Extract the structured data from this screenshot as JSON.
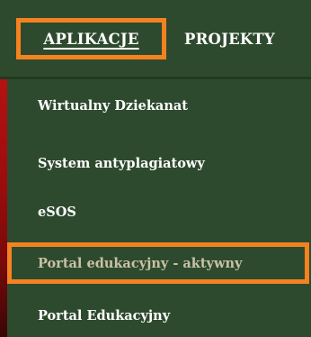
{
  "nav": {
    "items": [
      {
        "label": "APLIKACJE",
        "active": true
      },
      {
        "label": "PROJEKTY",
        "active": false
      }
    ]
  },
  "dropdown": {
    "items": [
      {
        "label": "Wirtualny Dziekanat"
      },
      {
        "label": "System antyplagiatowy"
      },
      {
        "label": "eSOS"
      },
      {
        "label": "Portal edukacyjny - aktywny",
        "highlighted": true
      },
      {
        "label": "Portal Edukacyjny"
      }
    ]
  },
  "colors": {
    "background": "#2e4a2e",
    "highlight_border": "#f58220",
    "text": "#ffffff",
    "active_text": "#c9c1a5",
    "side_strip": "#b51212"
  }
}
